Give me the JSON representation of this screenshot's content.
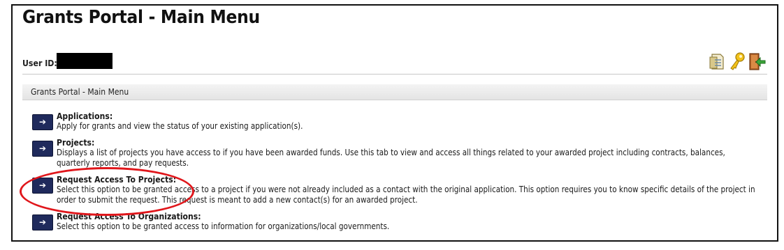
{
  "page": {
    "title": "Grants Portal - Main Menu"
  },
  "user": {
    "label": "User ID:"
  },
  "toolbar": {
    "icons": [
      "document-icon",
      "key-icon",
      "exit-door-icon"
    ]
  },
  "section": {
    "header": "Grants Portal - Main Menu"
  },
  "menu": {
    "button_glyph": "➔",
    "items": [
      {
        "title": "Applications:",
        "description": "Apply for grants and view the status of your existing application(s)."
      },
      {
        "title": "Projects:",
        "description": "Displays a list of projects you have access to if you have been awarded funds. Use this tab to view and access all things related to your awarded project including contracts, balances, quarterly reports, and pay requests."
      },
      {
        "title": "Request Access To Projects:",
        "description": "Select this option to be granted access to a project if you were not already included as a contact with the original application. This option requires you to know specific details of the project in order to submit the request. This request is meant to add a new contact(s) for an awarded project."
      },
      {
        "title": "Request Access To Organizations:",
        "description": "Select this option to be granted access to information for organizations/local governments."
      }
    ]
  },
  "annotation": {
    "color": "#e0161b"
  },
  "colors": {
    "button": "#1f2a5c",
    "header_bg": "#ececec"
  }
}
